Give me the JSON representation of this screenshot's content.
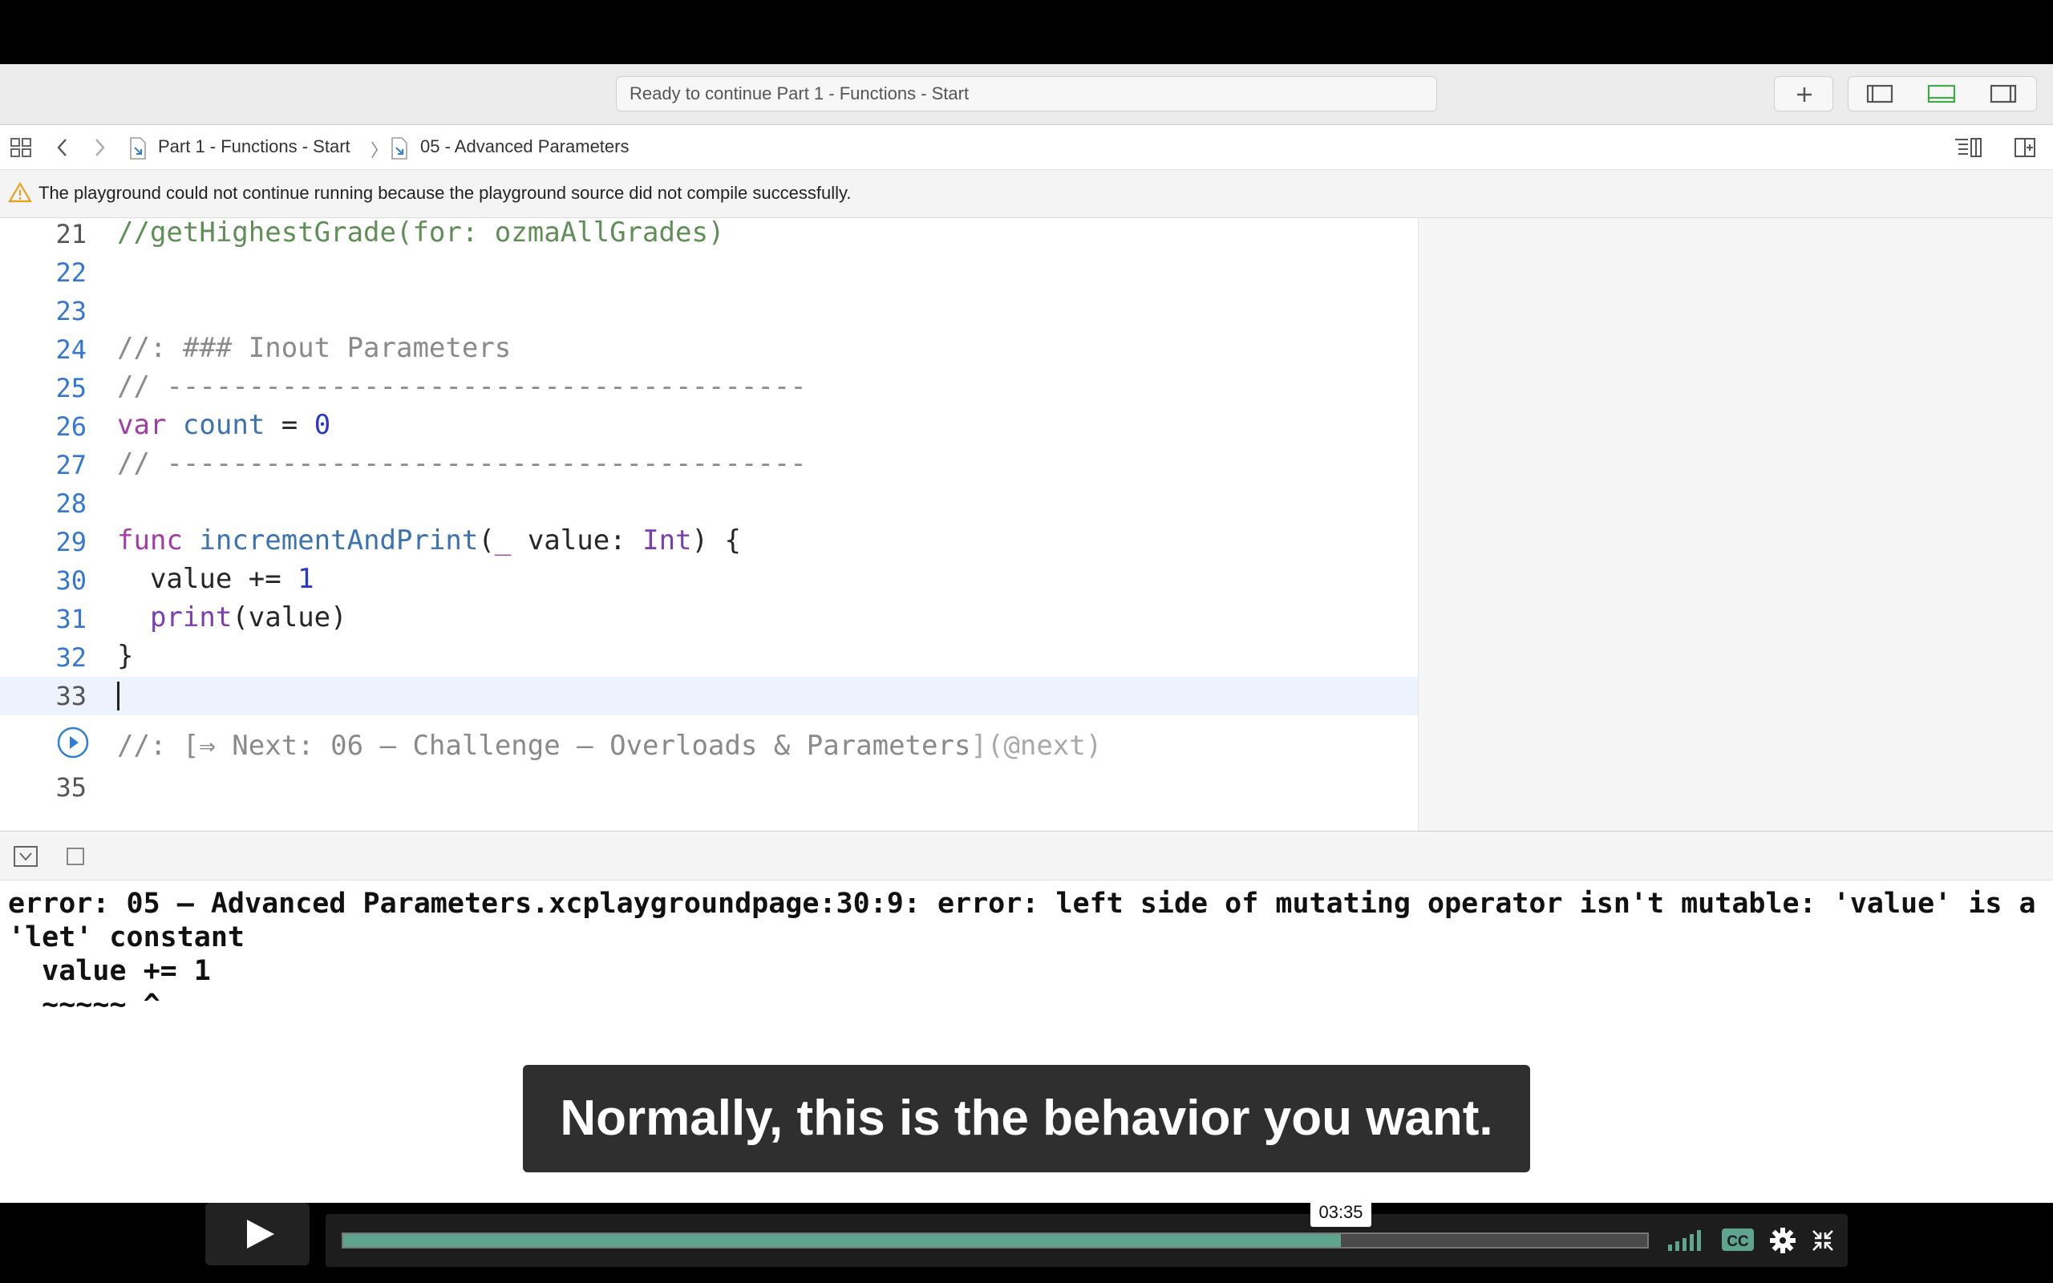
{
  "toolbar": {
    "status": "Ready to continue Part 1 - Functions - Start",
    "add_icon": "plus-icon",
    "panel_icons": [
      "navigator-panel-icon",
      "debug-area-icon",
      "inspector-panel-icon"
    ]
  },
  "jumpbar": {
    "project": "Part 1 - Functions - Start",
    "page": "05 - Advanced Parameters"
  },
  "warning": {
    "text": "The playground could not continue running because the playground source did not compile successfully."
  },
  "editor": {
    "lines": [
      {
        "n": "21",
        "t": "//getHighestGrade(for: ozmaAllGrades)"
      },
      {
        "n": "22",
        "t": ""
      },
      {
        "n": "23",
        "t": ""
      },
      {
        "n": "24",
        "t": "//: ### Inout Parameters"
      },
      {
        "n": "25",
        "t": "// ---------------------------------------"
      },
      {
        "n": "26",
        "t": "var count = 0"
      },
      {
        "n": "27",
        "t": "// ---------------------------------------"
      },
      {
        "n": "28",
        "t": ""
      },
      {
        "n": "29",
        "t": "func incrementAndPrint(_ value: Int) {"
      },
      {
        "n": "30",
        "t": "  value += 1"
      },
      {
        "n": "31",
        "t": "  print(value)"
      },
      {
        "n": "32",
        "t": "}"
      },
      {
        "n": "33",
        "t": ""
      },
      {
        "n": "",
        "t": "//: [⇒ Next: 06 – Challenge – Overloads & Parameters](@next)"
      },
      {
        "n": "35",
        "t": ""
      }
    ],
    "tok": {
      "l21": "//getHighestGrade(for: ozmaAllGrades)",
      "l24": "//: ### Inout Parameters",
      "l25": "// ---------------------------------------",
      "l26_kw": "var",
      "l26_id": "count",
      "l26_eq": " = ",
      "l26_num": "0",
      "l27": "// ---------------------------------------",
      "l29_kw": "func",
      "l29_fn": "incrementAndPrint",
      "l29_open": "(",
      "l29_us": "_",
      "l29_param": " value: ",
      "l29_ty": "Int",
      "l29_close": ") {",
      "l30_a": "  value += ",
      "l30_num": "1",
      "l31_pr": "print",
      "l31_rest": "(value)",
      "l32": "}",
      "l34_a": "//: [",
      "l34_b": "⇒ Next: 06 – Challenge – Overloads & Parameters",
      "l34_c": "](@next)"
    }
  },
  "console": {
    "text": "error: 05 – Advanced Parameters.xcplaygroundpage:30:9: error: left side of mutating operator isn't mutable: 'value' is a 'let' constant\n  value += 1\n  ~~~~~ ^"
  },
  "caption": {
    "text": "Normally, this is the behavior you want."
  },
  "player": {
    "time": "03:35",
    "progress": 0.765,
    "icons": [
      "play-icon",
      "volume-icon",
      "closed-captions-icon",
      "settings-icon",
      "fullscreen-icon"
    ],
    "accent": "#5fa48f"
  }
}
